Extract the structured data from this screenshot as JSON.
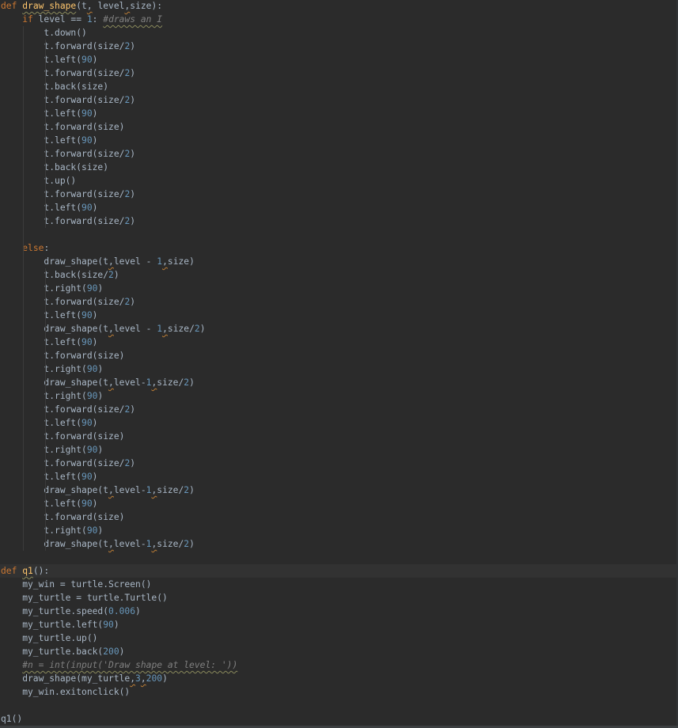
{
  "editor": {
    "language": "python",
    "colors": {
      "background": "#2b2b2b",
      "caret_line": "#323232",
      "default_text": "#a9b7c6",
      "keyword": "#cc7832",
      "function_name": "#ffc66d",
      "number": "#6897bb",
      "comment": "#808080",
      "string": "#6a8759"
    },
    "caret_line": 42,
    "lines": [
      [
        [
          "kw",
          "def"
        ],
        [
          "t",
          " "
        ],
        [
          "fn",
          "draw_shape"
        ],
        [
          "t",
          "(t"
        ],
        [
          "warn",
          ","
        ],
        [
          "t",
          " level"
        ],
        [
          "warn",
          ","
        ],
        [
          "t",
          "size):"
        ]
      ],
      [
        [
          "t",
          "    "
        ],
        [
          "kw",
          "if"
        ],
        [
          "t",
          " level == "
        ],
        [
          "num",
          "1"
        ],
        [
          "t",
          ": "
        ],
        [
          "cm",
          "#draws an I"
        ]
      ],
      [
        [
          "t",
          "        t.down()"
        ]
      ],
      [
        [
          "t",
          "        t.forward(size/"
        ],
        [
          "num",
          "2"
        ],
        [
          "t",
          ")"
        ]
      ],
      [
        [
          "t",
          "        t.left("
        ],
        [
          "num",
          "90"
        ],
        [
          "t",
          ")"
        ]
      ],
      [
        [
          "t",
          "        t.forward(size/"
        ],
        [
          "num",
          "2"
        ],
        [
          "t",
          ")"
        ]
      ],
      [
        [
          "t",
          "        t.back(size)"
        ]
      ],
      [
        [
          "t",
          "        t.forward(size/"
        ],
        [
          "num",
          "2"
        ],
        [
          "t",
          ")"
        ]
      ],
      [
        [
          "t",
          "        t.left("
        ],
        [
          "num",
          "90"
        ],
        [
          "t",
          ")"
        ]
      ],
      [
        [
          "t",
          "        t.forward(size)"
        ]
      ],
      [
        [
          "t",
          "        t.left("
        ],
        [
          "num",
          "90"
        ],
        [
          "t",
          ")"
        ]
      ],
      [
        [
          "t",
          "        t.forward(size/"
        ],
        [
          "num",
          "2"
        ],
        [
          "t",
          ")"
        ]
      ],
      [
        [
          "t",
          "        t.back(size)"
        ]
      ],
      [
        [
          "t",
          "        t.up()"
        ]
      ],
      [
        [
          "t",
          "        t.forward(size/"
        ],
        [
          "num",
          "2"
        ],
        [
          "t",
          ")"
        ]
      ],
      [
        [
          "t",
          "        t.left("
        ],
        [
          "num",
          "90"
        ],
        [
          "t",
          ")"
        ]
      ],
      [
        [
          "t",
          "        t.forward(size/"
        ],
        [
          "num",
          "2"
        ],
        [
          "t",
          ")"
        ]
      ],
      [],
      [
        [
          "t",
          "    "
        ],
        [
          "kw",
          "else"
        ],
        [
          "t",
          ":"
        ]
      ],
      [
        [
          "t",
          "        draw_shape(t"
        ],
        [
          "warn",
          ","
        ],
        [
          "t",
          "level - "
        ],
        [
          "num",
          "1"
        ],
        [
          "warn",
          ","
        ],
        [
          "t",
          "size)"
        ]
      ],
      [
        [
          "t",
          "        t.back(size/"
        ],
        [
          "num",
          "2"
        ],
        [
          "t",
          ")"
        ]
      ],
      [
        [
          "t",
          "        t.right("
        ],
        [
          "num",
          "90"
        ],
        [
          "t",
          ")"
        ]
      ],
      [
        [
          "t",
          "        t.forward(size/"
        ],
        [
          "num",
          "2"
        ],
        [
          "t",
          ")"
        ]
      ],
      [
        [
          "t",
          "        t.left("
        ],
        [
          "num",
          "90"
        ],
        [
          "t",
          ")"
        ]
      ],
      [
        [
          "t",
          "        draw_shape(t"
        ],
        [
          "warn",
          ","
        ],
        [
          "t",
          "level - "
        ],
        [
          "num",
          "1"
        ],
        [
          "warn",
          ","
        ],
        [
          "t",
          "size/"
        ],
        [
          "num",
          "2"
        ],
        [
          "t",
          ")"
        ]
      ],
      [
        [
          "t",
          "        t.left("
        ],
        [
          "num",
          "90"
        ],
        [
          "t",
          ")"
        ]
      ],
      [
        [
          "t",
          "        t.forward(size)"
        ]
      ],
      [
        [
          "t",
          "        t.right("
        ],
        [
          "num",
          "90"
        ],
        [
          "t",
          ")"
        ]
      ],
      [
        [
          "t",
          "        draw_shape(t"
        ],
        [
          "warn",
          ","
        ],
        [
          "t",
          "level-"
        ],
        [
          "num",
          "1"
        ],
        [
          "warn",
          ","
        ],
        [
          "t",
          "size/"
        ],
        [
          "num",
          "2"
        ],
        [
          "t",
          ")"
        ]
      ],
      [
        [
          "t",
          "        t.right("
        ],
        [
          "num",
          "90"
        ],
        [
          "t",
          ")"
        ]
      ],
      [
        [
          "t",
          "        t.forward(size/"
        ],
        [
          "num",
          "2"
        ],
        [
          "t",
          ")"
        ]
      ],
      [
        [
          "t",
          "        t.left("
        ],
        [
          "num",
          "90"
        ],
        [
          "t",
          ")"
        ]
      ],
      [
        [
          "t",
          "        t.forward(size)"
        ]
      ],
      [
        [
          "t",
          "        t.right("
        ],
        [
          "num",
          "90"
        ],
        [
          "t",
          ")"
        ]
      ],
      [
        [
          "t",
          "        t.forward(size/"
        ],
        [
          "num",
          "2"
        ],
        [
          "t",
          ")"
        ]
      ],
      [
        [
          "t",
          "        t.left("
        ],
        [
          "num",
          "90"
        ],
        [
          "t",
          ")"
        ]
      ],
      [
        [
          "t",
          "        draw_shape(t"
        ],
        [
          "warn",
          ","
        ],
        [
          "t",
          "level-"
        ],
        [
          "num",
          "1"
        ],
        [
          "warn",
          ","
        ],
        [
          "t",
          "size/"
        ],
        [
          "num",
          "2"
        ],
        [
          "t",
          ")"
        ]
      ],
      [
        [
          "t",
          "        t.left("
        ],
        [
          "num",
          "90"
        ],
        [
          "t",
          ")"
        ]
      ],
      [
        [
          "t",
          "        t.forward(size)"
        ]
      ],
      [
        [
          "t",
          "        t.right("
        ],
        [
          "num",
          "90"
        ],
        [
          "t",
          ")"
        ]
      ],
      [
        [
          "t",
          "        draw_shape(t"
        ],
        [
          "warn",
          ","
        ],
        [
          "t",
          "level-"
        ],
        [
          "num",
          "1"
        ],
        [
          "warn",
          ","
        ],
        [
          "t",
          "size/"
        ],
        [
          "num",
          "2"
        ],
        [
          "t",
          ")"
        ]
      ],
      [],
      [
        [
          "kw",
          "def"
        ],
        [
          "t",
          " "
        ],
        [
          "fn",
          "q1"
        ],
        [
          "t",
          "():"
        ]
      ],
      [
        [
          "t",
          "    my_win = turtle.Screen()"
        ]
      ],
      [
        [
          "t",
          "    my_turtle = turtle.Turtle()"
        ]
      ],
      [
        [
          "t",
          "    my_turtle.speed("
        ],
        [
          "num",
          "0.006"
        ],
        [
          "t",
          ")"
        ]
      ],
      [
        [
          "t",
          "    my_turtle.left("
        ],
        [
          "num",
          "90"
        ],
        [
          "t",
          ")"
        ]
      ],
      [
        [
          "t",
          "    my_turtle.up()"
        ]
      ],
      [
        [
          "t",
          "    my_turtle.back("
        ],
        [
          "num",
          "200"
        ],
        [
          "t",
          ")"
        ]
      ],
      [
        [
          "t",
          "    "
        ],
        [
          "cm",
          "#n = int(input('Draw shape at level: '))"
        ]
      ],
      [
        [
          "t",
          "    draw_shape(my_turtle"
        ],
        [
          "warn",
          ","
        ],
        [
          "num",
          "3"
        ],
        [
          "warn",
          ","
        ],
        [
          "num",
          "200"
        ],
        [
          "t",
          ")"
        ]
      ],
      [
        [
          "t",
          "    my_win.exitonclick()"
        ]
      ],
      [],
      [
        [
          "t",
          "q1()"
        ]
      ]
    ]
  }
}
